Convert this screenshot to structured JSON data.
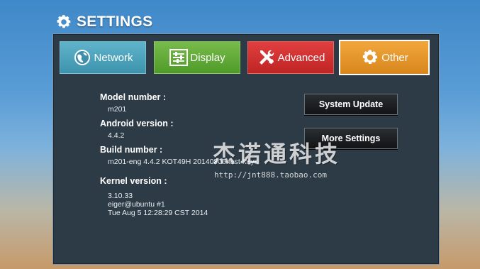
{
  "header": {
    "title": "SETTINGS",
    "icon": "gear-icon"
  },
  "tabs": [
    {
      "label": "Network",
      "icon": "globe-icon",
      "color": "#4aa3bd"
    },
    {
      "label": "Display",
      "icon": "sliders-icon",
      "color": "#5ea636"
    },
    {
      "label": "Advanced",
      "icon": "tools-icon",
      "color": "#d0302f"
    },
    {
      "label": "Other",
      "icon": "gear-icon",
      "color": "#e4962a",
      "selected": true
    }
  ],
  "info": {
    "model_label": "Model number :",
    "model_value": "m201",
    "android_label": "Android version :",
    "android_value": "4.4.2",
    "build_label": "Build number :",
    "build_value": "m201-eng 4.4.2 KOT49H 20140805 test-keys",
    "kernel_label": "Kernel version :",
    "kernel_lines": [
      "3.10.33",
      "eiger@ubuntu #1",
      "Tue Aug 5 12:28:29 CST 2014"
    ]
  },
  "buttons": {
    "system_update": "System Update",
    "more_settings": "More Settings"
  },
  "watermark": {
    "text": "杰诺通科技",
    "url": "http://jnt888.taobao.com"
  }
}
